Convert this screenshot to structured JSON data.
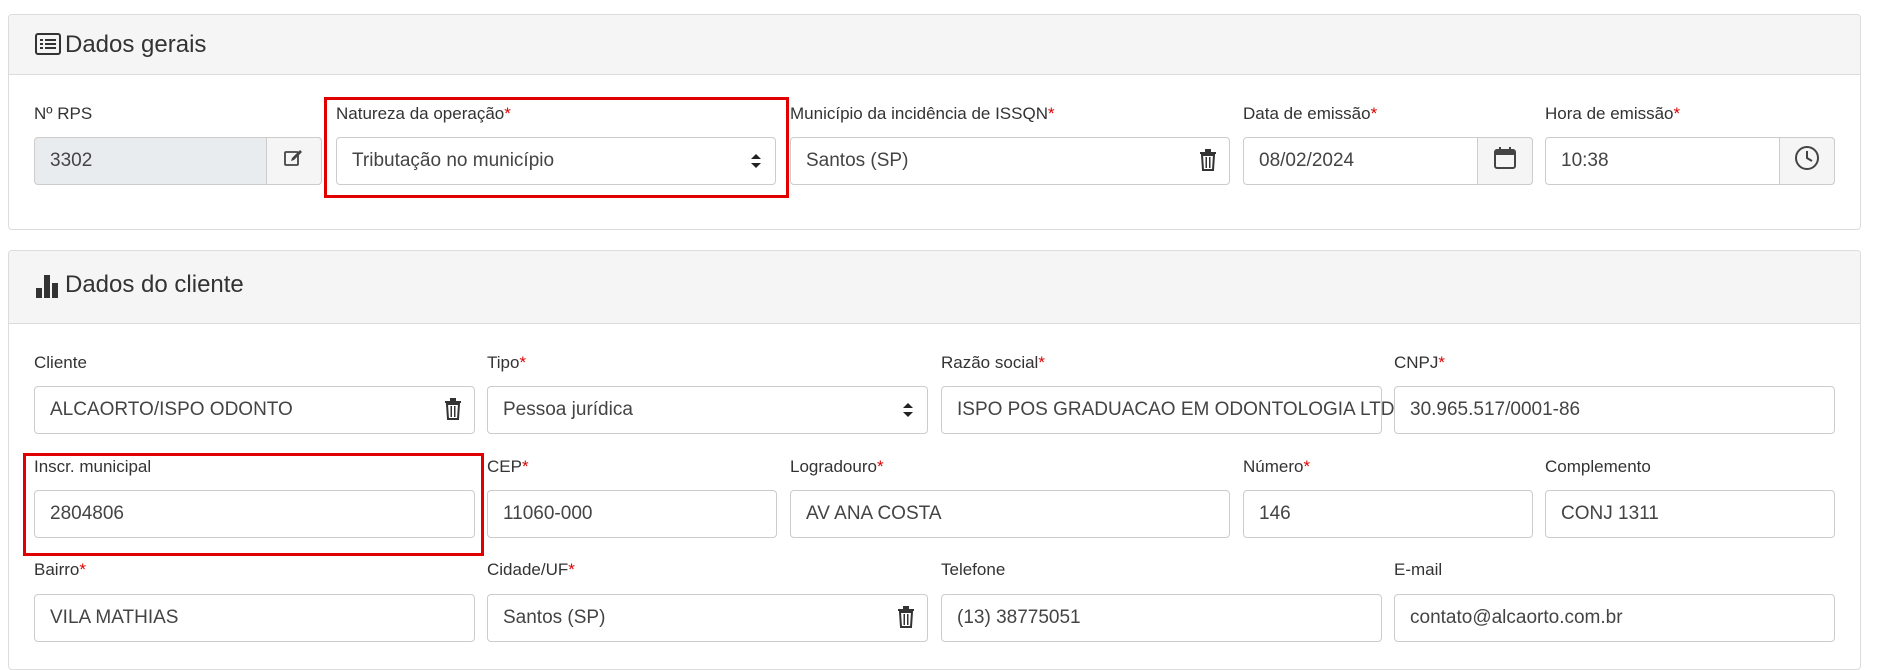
{
  "dados_gerais": {
    "title": "Dados gerais",
    "rps": {
      "label": "Nº RPS",
      "value": "3302"
    },
    "natureza": {
      "label": "Natureza da operação",
      "required": "*",
      "value": "Tributação no município"
    },
    "municipio": {
      "label": "Município da incidência de ISSQN",
      "required": "*",
      "value": "Santos (SP)"
    },
    "data_emissao": {
      "label": "Data de emissão",
      "required": "*",
      "value": "08/02/2024"
    },
    "hora_emissao": {
      "label": "Hora de emissão",
      "required": "*",
      "value": "10:38"
    }
  },
  "dados_cliente": {
    "title": "Dados do cliente",
    "cliente": {
      "label": "Cliente",
      "value": "ALCAORTO/ISPO ODONTO"
    },
    "tipo": {
      "label": "Tipo",
      "required": "*",
      "value": "Pessoa jurídica"
    },
    "razao_social": {
      "label": "Razão social",
      "required": "*",
      "value": "ISPO POS GRADUACAO EM ODONTOLOGIA LTDA"
    },
    "cnpj": {
      "label": "CNPJ",
      "required": "*",
      "value": "30.965.517/0001-86"
    },
    "inscr_municipal": {
      "label": "Inscr. municipal",
      "value": "2804806"
    },
    "cep": {
      "label": "CEP",
      "required": "*",
      "value": "11060-000"
    },
    "logradouro": {
      "label": "Logradouro",
      "required": "*",
      "value": "AV ANA COSTA"
    },
    "numero": {
      "label": "Número",
      "required": "*",
      "value": "146"
    },
    "complemento": {
      "label": "Complemento",
      "value": "CONJ 1311"
    },
    "bairro": {
      "label": "Bairro",
      "required": "*",
      "value": "VILA MATHIAS"
    },
    "cidade_uf": {
      "label": "Cidade/UF",
      "required": "*",
      "value": "Santos (SP)"
    },
    "telefone": {
      "label": "Telefone",
      "value": "(13) 38775051"
    },
    "email": {
      "label": "E-mail",
      "value": "contato@alcaorto.com.br"
    }
  },
  "colors": {
    "highlight": "#e00000",
    "required": "#dd0000",
    "addon_bg": "#f5f5f5",
    "readonly_bg": "#e9ecef"
  },
  "icons": [
    "list-icon",
    "edit-icon",
    "sort-arrows-icon",
    "trash-icon",
    "calendar-icon",
    "clock-icon",
    "bar-chart-icon"
  ]
}
